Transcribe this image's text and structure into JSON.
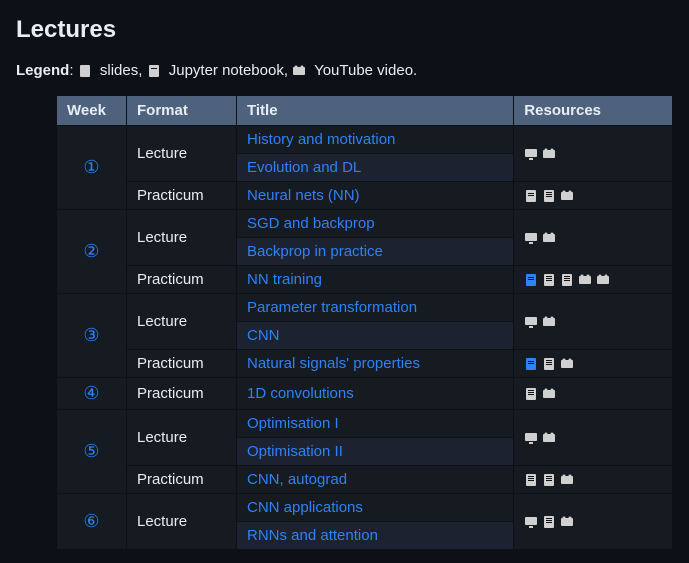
{
  "heading": "Lectures",
  "legend": {
    "label": "Legend",
    "slides": "slides,",
    "notebook": "Jupyter notebook,",
    "video": "YouTube video."
  },
  "columns": {
    "week": "Week",
    "format": "Format",
    "title": "Title",
    "resources": "Resources"
  },
  "weeks": [
    {
      "num": "①",
      "rows": [
        {
          "format": "Lecture",
          "format_span": 2,
          "titles": [
            "History and motivation",
            "Evolution and DL"
          ],
          "res": [
            "screen",
            "video"
          ]
        },
        {
          "format": "Practicum",
          "format_span": 1,
          "titles": [
            "Neural nets (NN)"
          ],
          "res": [
            "slides",
            "notebook",
            "video"
          ]
        }
      ]
    },
    {
      "num": "②",
      "rows": [
        {
          "format": "Lecture",
          "format_span": 2,
          "titles": [
            "SGD and backprop",
            "Backprop in practice"
          ],
          "res": [
            "screen",
            "video"
          ]
        },
        {
          "format": "Practicum",
          "format_span": 1,
          "titles": [
            "NN training"
          ],
          "res": [
            "slides-active",
            "notebook",
            "notebook",
            "video",
            "video"
          ]
        }
      ]
    },
    {
      "num": "③",
      "rows": [
        {
          "format": "Lecture",
          "format_span": 2,
          "titles": [
            "Parameter transformation",
            "CNN"
          ],
          "res": [
            "screen",
            "video"
          ]
        },
        {
          "format": "Practicum",
          "format_span": 1,
          "titles": [
            "Natural signals' properties"
          ],
          "res": [
            "slides-active",
            "notebook",
            "video"
          ]
        }
      ]
    },
    {
      "num": "④",
      "rows": [
        {
          "format": "Practicum",
          "format_span": 1,
          "titles": [
            "1D convolutions"
          ],
          "res": [
            "notebook",
            "video"
          ]
        }
      ]
    },
    {
      "num": "⑤",
      "rows": [
        {
          "format": "Lecture",
          "format_span": 2,
          "titles": [
            "Optimisation I",
            "Optimisation II"
          ],
          "res": [
            "screen",
            "video"
          ]
        },
        {
          "format": "Practicum",
          "format_span": 1,
          "titles": [
            "CNN, autograd"
          ],
          "res": [
            "notebook",
            "notebook",
            "video"
          ]
        }
      ]
    },
    {
      "num": "⑥",
      "rows": [
        {
          "format": "Lecture",
          "format_span": 2,
          "titles": [
            "CNN applications",
            "RNNs and attention"
          ],
          "res": [
            "screen",
            "notebook",
            "video"
          ]
        }
      ]
    }
  ]
}
